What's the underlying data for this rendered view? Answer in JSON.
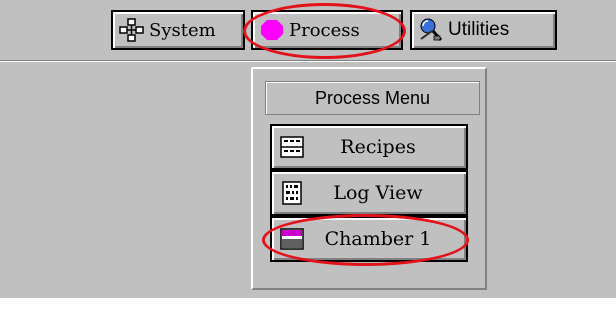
{
  "toolbar": {
    "system_label": "System",
    "process_label": "Process",
    "utilities_label": "Utilities"
  },
  "process_menu": {
    "title": "Process Menu",
    "items": [
      {
        "label": "Recipes",
        "icon": "recipes-icon"
      },
      {
        "label": "Log View",
        "icon": "log-view-icon"
      },
      {
        "label": "Chamber 1",
        "icon": "chamber-icon"
      }
    ]
  },
  "colors": {
    "process_icon": "#ff00ff",
    "chamber_icon_top": "#cc00cc",
    "highlight_ring": "#e3121a",
    "face": "#c0c0c0"
  }
}
